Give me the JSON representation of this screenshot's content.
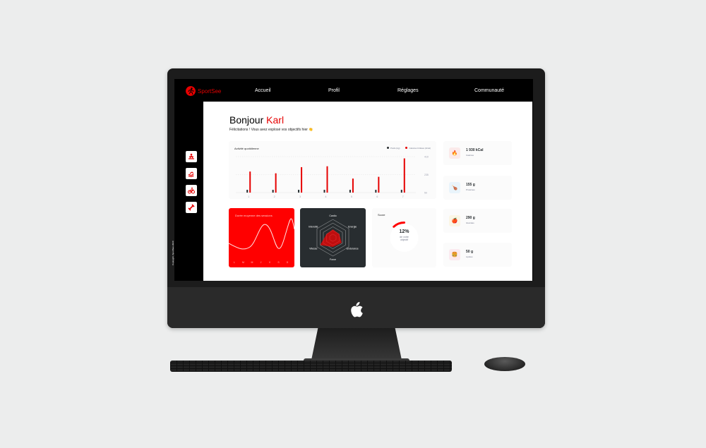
{
  "brand": {
    "name": "SportSee",
    "accent": "#e60000"
  },
  "nav": {
    "items": [
      "Accueil",
      "Profil",
      "Réglages",
      "Communauté"
    ]
  },
  "sidebar": {
    "icons": [
      "meditation-icon",
      "swim-icon",
      "bike-icon",
      "dumbbell-icon"
    ],
    "copyright": "Copiryght, SportSee 2020"
  },
  "greeting": {
    "hello": "Bonjour ",
    "name": "Karl",
    "message": "Félicitations ! Vous avez explosé vos objectifs hier 👏"
  },
  "activity": {
    "title": "Activité quotidienne",
    "legend": {
      "weight": "Poids (kg)",
      "calories": "Calories brûlées (kCal)"
    },
    "yticks": [
      "410",
      "235",
      "50"
    ]
  },
  "chart_data": [
    {
      "type": "bar",
      "title": "Activité quotidienne",
      "categories": [
        "1",
        "2",
        "3",
        "4",
        "5",
        "6",
        "7"
      ],
      "series": [
        {
          "name": "Poids (kg)",
          "values": [
            50,
            50,
            50,
            50,
            50,
            50,
            50
          ],
          "color": "#282d30"
        },
        {
          "name": "Calories brûlées (kCal)",
          "values": [
            240,
            220,
            290,
            300,
            160,
            180,
            390
          ],
          "color": "#e60000"
        }
      ],
      "ylim": [
        0,
        410
      ]
    },
    {
      "type": "line",
      "title": "Durée moyenne des sessions",
      "categories": [
        "L",
        "M",
        "M",
        "J",
        "V",
        "S",
        "D"
      ],
      "series": [
        {
          "values": [
            30,
            23,
            45,
            50,
            0,
            0,
            60
          ]
        }
      ]
    },
    {
      "type": "radar",
      "categories": [
        "Cardio",
        "Energie",
        "Endurance",
        "Force",
        "Vitesse",
        "Intensité"
      ],
      "series": [
        {
          "values": [
            0.45,
            0.4,
            0.55,
            0.5,
            0.8,
            0.4
          ]
        }
      ]
    },
    {
      "type": "pie",
      "title": "Score",
      "values": [
        12
      ]
    }
  ],
  "duration": {
    "title": "Durée moyenne des sessions",
    "days": [
      "L",
      "M",
      "M",
      "J",
      "V",
      "S",
      "D"
    ]
  },
  "radar": {
    "labels": [
      "Cardio",
      "Energie",
      "Endurance",
      "Force",
      "Vitesse",
      "Intensité"
    ]
  },
  "score": {
    "title": "Score",
    "percent": "12%",
    "caption1": "de votre",
    "caption2": "objectif"
  },
  "stats": [
    {
      "value": "1 930 kCal",
      "label": "Calories",
      "icon": "flame-icon",
      "bg": "#fbeaea",
      "color": "#e60000",
      "glyph": "🔥"
    },
    {
      "value": "155 g",
      "label": "Protéines",
      "icon": "chicken-icon",
      "bg": "#e9f4fb",
      "color": "#4ab8ff",
      "glyph": "🍗"
    },
    {
      "value": "290 g",
      "label": "Glucides",
      "icon": "apple-icon",
      "bg": "#fbf6e5",
      "color": "#fdcc0c",
      "glyph": "🍎"
    },
    {
      "value": "50 g",
      "label": "Lipides",
      "icon": "burger-icon",
      "bg": "#fbeaef",
      "color": "#fd5181",
      "glyph": "🍔"
    }
  ]
}
